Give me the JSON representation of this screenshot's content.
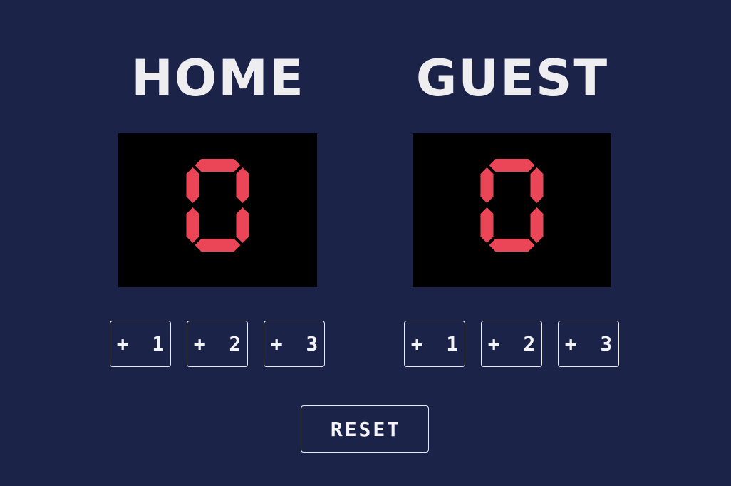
{
  "colors": {
    "background": "#1c2349",
    "scoreboard": "#000000",
    "digit": "#eb4658",
    "text": "#eeeef1"
  },
  "home": {
    "name": "HOME",
    "score": "0",
    "buttons": [
      "+ 1",
      "+ 2",
      "+ 3"
    ]
  },
  "guest": {
    "name": "GUEST",
    "score": "0",
    "buttons": [
      "+ 1",
      "+ 2",
      "+ 3"
    ]
  },
  "reset_label": "RESET"
}
